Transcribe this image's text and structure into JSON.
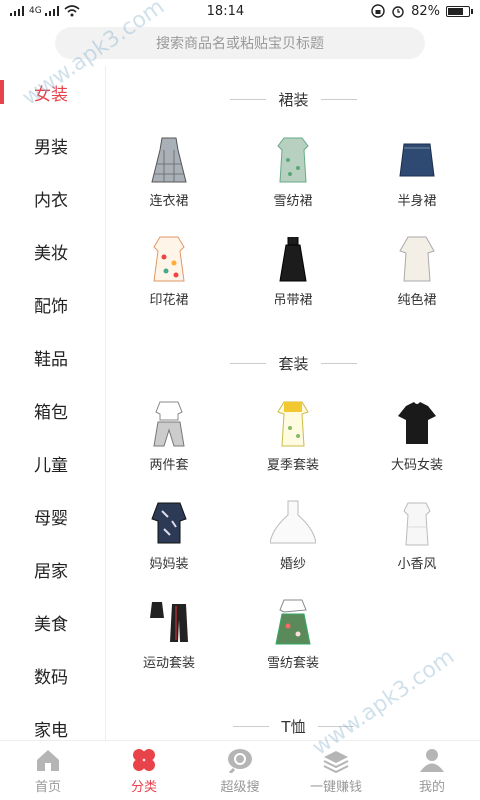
{
  "status": {
    "network": "4G",
    "time": "18:14",
    "battery_pct": "82%",
    "battery_level": 0.82
  },
  "search": {
    "placeholder": "搜索商品名或粘贴宝贝标题"
  },
  "sidebar": {
    "items": [
      {
        "label": "女装",
        "active": true
      },
      {
        "label": "男装"
      },
      {
        "label": "内衣"
      },
      {
        "label": "美妆"
      },
      {
        "label": "配饰"
      },
      {
        "label": "鞋品"
      },
      {
        "label": "箱包"
      },
      {
        "label": "儿童"
      },
      {
        "label": "母婴"
      },
      {
        "label": "居家"
      },
      {
        "label": "美食"
      },
      {
        "label": "数码"
      },
      {
        "label": "家电"
      }
    ]
  },
  "sections": [
    {
      "title": "裙装",
      "items": [
        {
          "label": "连衣裙",
          "icon": "plaid-dress-icon"
        },
        {
          "label": "雪纺裙",
          "icon": "chiffon-dress-icon"
        },
        {
          "label": "半身裙",
          "icon": "denim-skirt-icon"
        },
        {
          "label": "印花裙",
          "icon": "print-dress-icon"
        },
        {
          "label": "吊带裙",
          "icon": "slip-dress-icon"
        },
        {
          "label": "纯色裙",
          "icon": "solid-dress-icon"
        }
      ]
    },
    {
      "title": "套装",
      "items": [
        {
          "label": "两件套",
          "icon": "two-piece-icon"
        },
        {
          "label": "夏季套装",
          "icon": "summer-set-icon"
        },
        {
          "label": "大码女装",
          "icon": "plus-size-tee-icon"
        },
        {
          "label": "妈妈装",
          "icon": "mom-wear-icon"
        },
        {
          "label": "婚纱",
          "icon": "wedding-dress-icon"
        },
        {
          "label": "小香风",
          "icon": "tweed-dress-icon"
        },
        {
          "label": "运动套装",
          "icon": "sport-set-icon"
        },
        {
          "label": "雪纺套装",
          "icon": "chiffon-set-icon"
        }
      ]
    },
    {
      "title": "T恤",
      "items": []
    }
  ],
  "tabbar": {
    "items": [
      {
        "label": "首页",
        "icon": "home-icon"
      },
      {
        "label": "分类",
        "icon": "category-icon",
        "active": true
      },
      {
        "label": "超级搜",
        "icon": "super-search-icon"
      },
      {
        "label": "一键赚钱",
        "icon": "earn-money-icon"
      },
      {
        "label": "我的",
        "icon": "profile-icon"
      }
    ]
  },
  "watermark": "www.apk3.com"
}
